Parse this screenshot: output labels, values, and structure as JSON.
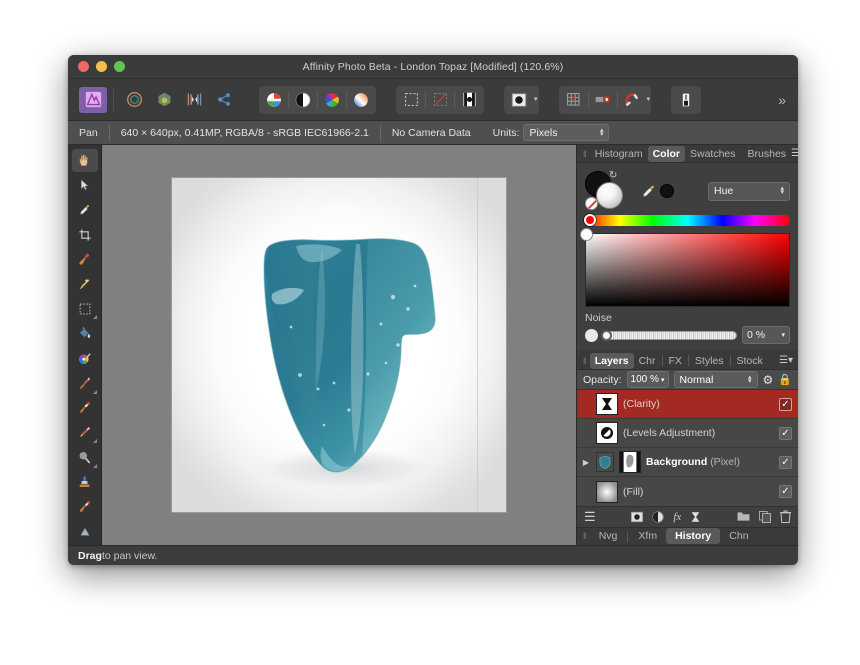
{
  "window": {
    "title": "Affinity Photo Beta - London Topaz [Modified] (120.6%)",
    "traffic_lights": [
      "close",
      "minimize",
      "zoom"
    ]
  },
  "toolbar": {
    "items": [
      {
        "name": "affinity-photo-persona",
        "label": "Photo Persona",
        "state": "active"
      },
      {
        "name": "liquify-persona",
        "label": "Liquify Persona"
      },
      {
        "name": "develop-persona",
        "label": "Develop Persona"
      },
      {
        "name": "tone-mapping-persona",
        "label": "Tone Mapping Persona"
      },
      {
        "name": "export-persona",
        "label": "Export Persona"
      },
      {
        "name": "adjustment-button",
        "label": "Adjustment"
      },
      {
        "name": "live-filter-button",
        "label": "Live Filter"
      },
      {
        "name": "colour-button",
        "label": "Colour"
      },
      {
        "name": "gradient-button",
        "label": "Gradient"
      },
      {
        "name": "marquee-select-button",
        "label": "Marquee Selection"
      },
      {
        "name": "no-selection-button",
        "label": "Deselect"
      },
      {
        "name": "refine-selection-button",
        "label": "Refine Selection"
      },
      {
        "name": "mask-button",
        "label": "Mask"
      },
      {
        "name": "grid-button",
        "label": "Show Grid"
      },
      {
        "name": "snapping-button",
        "label": "Snapping"
      },
      {
        "name": "magnet-button",
        "label": "Magnetic Snapping"
      },
      {
        "name": "assistant-button",
        "label": "Assistant"
      }
    ],
    "overflow_label": "»"
  },
  "context_bar": {
    "tool_name": "Pan",
    "doc_info": "640 × 640px, 0.41MP, RGBA/8 - sRGB IEC61966-2.1",
    "camera": "No Camera Data",
    "units_label": "Units:",
    "units_value": "Pixels"
  },
  "tools": [
    {
      "name": "view-tool",
      "label": "View Tool",
      "glyph": "✋",
      "selected": true,
      "more": false
    },
    {
      "name": "move-tool",
      "label": "Move Tool",
      "glyph": "➤",
      "selected": false,
      "more": false
    },
    {
      "name": "colour-picker-tool",
      "label": "Colour Picker Tool",
      "glyph": "✒",
      "selected": false,
      "more": false
    },
    {
      "name": "crop-tool",
      "label": "Crop Tool",
      "glyph": "⛶",
      "selected": false,
      "more": false
    },
    {
      "name": "selection-brush-tool",
      "label": "Selection Brush Tool",
      "glyph": "✒",
      "selected": false,
      "more": false
    },
    {
      "name": "flood-select-tool",
      "label": "Flood Select Tool",
      "glyph": "✨",
      "selected": false,
      "more": false
    },
    {
      "name": "marquee-tool",
      "label": "Rectangular Marquee",
      "glyph": "⬚",
      "selected": false,
      "more": true
    },
    {
      "name": "flood-fill-tool",
      "label": "Flood Fill Tool",
      "glyph": "🪣",
      "selected": false,
      "more": false
    },
    {
      "name": "paint-mixer-tool",
      "label": "Paint Mixer Brush",
      "glyph": "🎨",
      "selected": false,
      "more": false
    },
    {
      "name": "paint-brush-tool",
      "label": "Paint Brush Tool",
      "glyph": "🖌",
      "selected": false,
      "more": true
    },
    {
      "name": "colour-replace-tool",
      "label": "Colour Replacement",
      "glyph": "🖌",
      "selected": false,
      "more": false
    },
    {
      "name": "erase-brush-tool",
      "label": "Erase Brush Tool",
      "glyph": "✏",
      "selected": false,
      "more": true
    },
    {
      "name": "blur-brush-tool",
      "label": "Blur Brush Tool",
      "glyph": "🔎",
      "selected": false,
      "more": true
    },
    {
      "name": "clone-brush-tool",
      "label": "Clone Brush Tool",
      "glyph": "🖲",
      "selected": false,
      "more": false
    },
    {
      "name": "healing-brush-tool",
      "label": "Healing Brush Tool",
      "glyph": "🖌",
      "selected": false,
      "more": false
    },
    {
      "name": "dodge-brush-tool",
      "label": "Dodge Brush Tool",
      "glyph": "▲",
      "selected": false,
      "more": false
    }
  ],
  "canvas": {
    "subject": "blue-green topaz crystal on white background",
    "zoom": "120.6%"
  },
  "status": {
    "action": "Drag",
    "hint": " to pan view."
  },
  "color_panel": {
    "tabs": [
      {
        "label": "Histogram",
        "active": false
      },
      {
        "label": "Color",
        "active": true
      },
      {
        "label": "Swatches",
        "active": false
      },
      {
        "label": "Brushes",
        "active": false
      }
    ],
    "mode": "Hue",
    "noise_label": "Noise",
    "noise_value": "0 %",
    "accent_hue": "#ff0000"
  },
  "layers_panel": {
    "tabs": [
      {
        "label": "Layers",
        "active": true
      },
      {
        "label": "Chr",
        "active": false
      },
      {
        "label": "FX",
        "active": false
      },
      {
        "label": "Styles",
        "active": false
      },
      {
        "label": "Stock",
        "active": false
      }
    ],
    "opacity_label": "Opacity:",
    "opacity_value": "100 %",
    "blend_mode": "Normal",
    "selected_color": "#a32a22",
    "layers": [
      {
        "name": "(Clarity)",
        "type": "",
        "selected": true,
        "visible": true,
        "check": "✓",
        "expandable": false,
        "thumb": "clarity"
      },
      {
        "name": "(Levels Adjustment)",
        "type": "",
        "selected": false,
        "visible": true,
        "check": "✓",
        "expandable": false,
        "thumb": "levels"
      },
      {
        "name": "Background",
        "type": "(Pixel)",
        "selected": false,
        "visible": true,
        "check": "✓",
        "expandable": true,
        "thumb": "background"
      },
      {
        "name": "(Fill)",
        "type": "",
        "selected": false,
        "visible": true,
        "check": "✓",
        "expandable": false,
        "thumb": "fill"
      }
    ],
    "toolbar_icons": [
      {
        "name": "layers-stack-icon",
        "glyph": "≣"
      },
      {
        "name": "mask-layer-icon",
        "glyph": "▣"
      },
      {
        "name": "adjustment-layer-icon",
        "glyph": "◑"
      },
      {
        "name": "fx-layer-icon",
        "glyph": "fx"
      },
      {
        "name": "live-filter-layer-icon",
        "glyph": "⧗"
      },
      {
        "name": "group-layer-icon",
        "glyph": "▭"
      },
      {
        "name": "duplicate-layer-icon",
        "glyph": "⧉"
      },
      {
        "name": "delete-layer-icon",
        "glyph": "🗑"
      }
    ]
  },
  "bottom_tabs": [
    {
      "label": "Nvg",
      "active": false
    },
    {
      "label": "Xfm",
      "active": false
    },
    {
      "label": "History",
      "active": true
    },
    {
      "label": "Chn",
      "active": false
    }
  ]
}
